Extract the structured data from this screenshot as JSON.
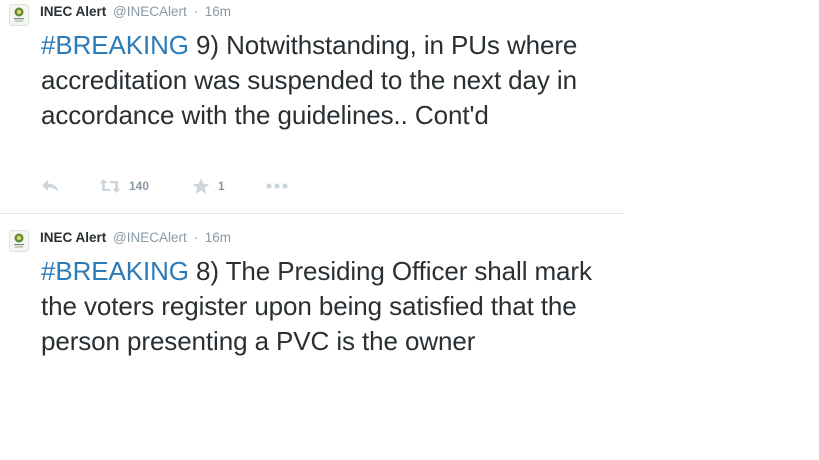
{
  "tweets": [
    {
      "author_name": "INEC Alert",
      "author_handle": "@INECAlert",
      "separator": "·",
      "time": "16m",
      "hashtag": "#BREAKING",
      "text": " 9) Notwithstanding, in PUs where accreditation was suspended to the next day in accordance with the guidelines.. Cont'd",
      "retweet_count": "140",
      "favorite_count": "1",
      "avatar_icon": "inec-logo-icon",
      "action_icons": [
        "reply-icon",
        "retweet-icon",
        "star-icon",
        "more-icon"
      ]
    },
    {
      "author_name": "INEC Alert",
      "author_handle": "@INECAlert",
      "separator": "·",
      "time": "16m",
      "hashtag": "#BREAKING",
      "text": " 8) The Presiding Officer shall mark the voters register upon being satisfied that the person presenting a PVC is the owner",
      "avatar_icon": "inec-logo-icon"
    }
  ],
  "colors": {
    "text": "#292f33",
    "meta": "#8899a6",
    "hashtag": "#2b7bb9",
    "action_icon": "#ccd6dd",
    "divider": "#e1e8ed"
  }
}
